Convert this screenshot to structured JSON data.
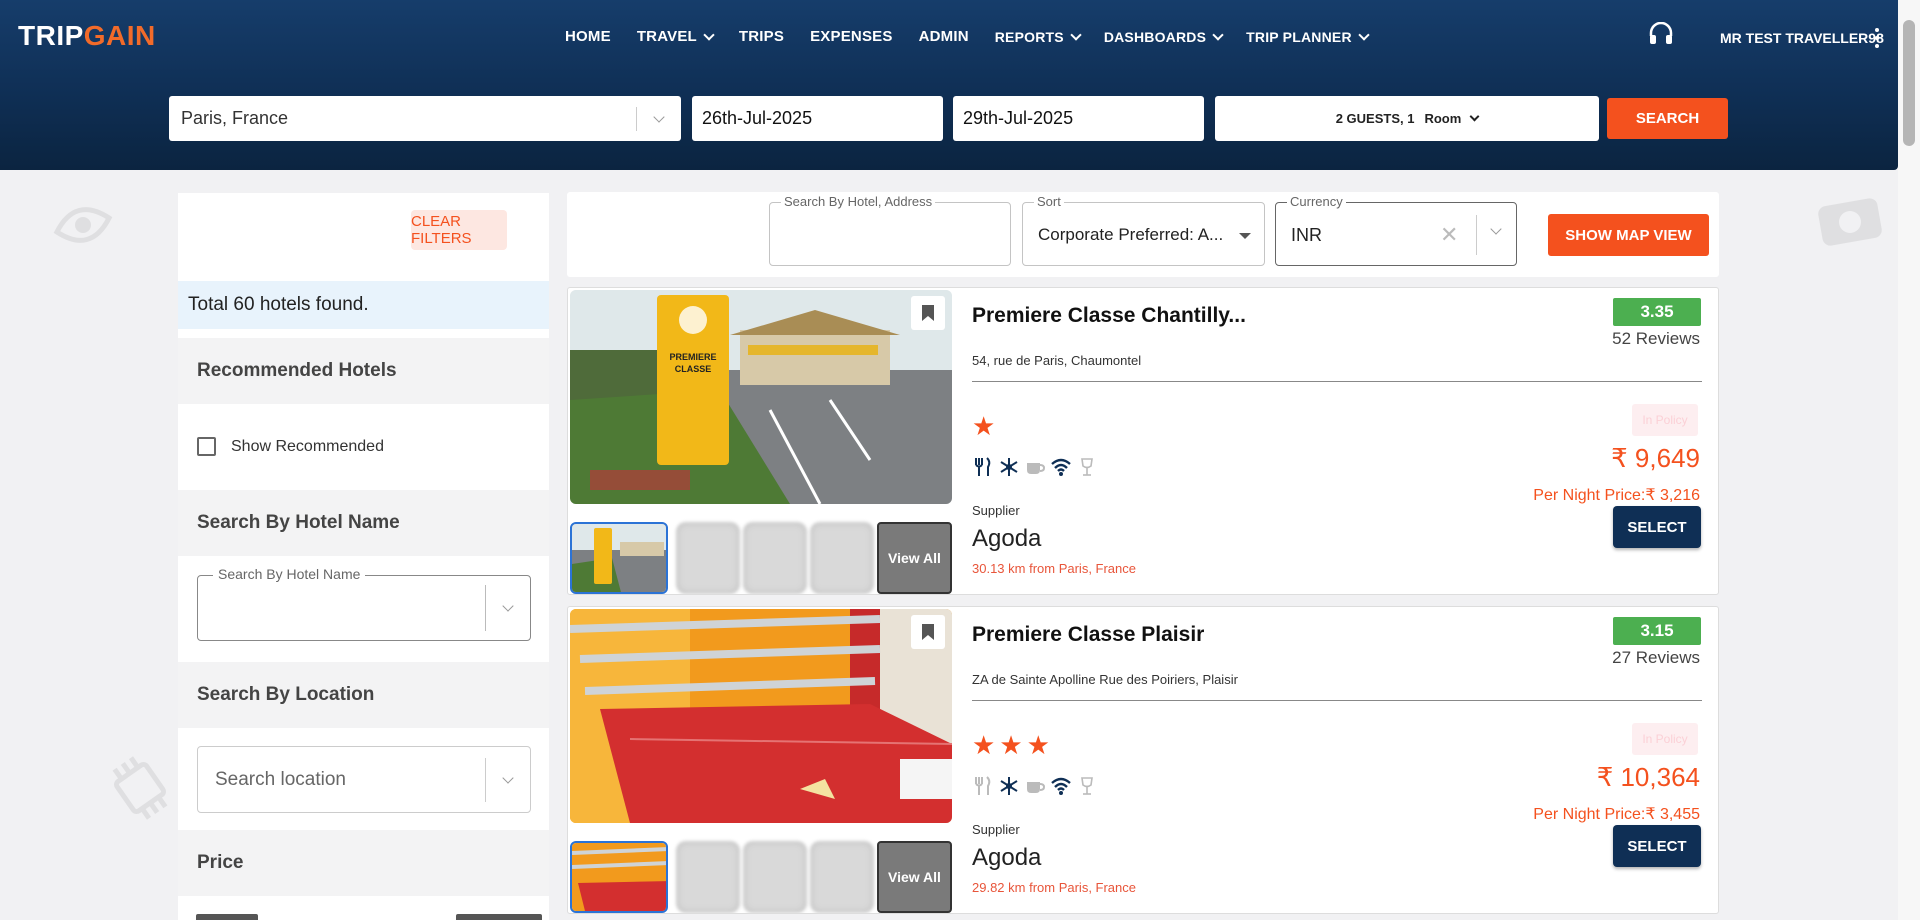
{
  "header": {
    "logo_text_a": "TRIP",
    "logo_text_b": "GAIN",
    "nav": [
      {
        "label": "HOME"
      },
      {
        "label": "TRAVEL",
        "dropdown": true
      },
      {
        "label": "TRIPS"
      },
      {
        "label": "EXPENSES"
      },
      {
        "label": "ADMIN"
      },
      {
        "label": "REPORTS",
        "dropdown": true
      },
      {
        "label": "DASHBOARDS",
        "dropdown": true
      },
      {
        "label": "TRIP PLANNER",
        "dropdown": true
      }
    ],
    "user_name": "MR TEST TRAVELLER98"
  },
  "search": {
    "destination": "Paris, France",
    "check_in": "26th-Jul-2025",
    "check_out": "29th-Jul-2025",
    "guests": "2 GUESTS, 1",
    "room": "Room",
    "search_label": "SEARCH"
  },
  "sidebar": {
    "clear_filters": "CLEAR FILTERS",
    "total": "Total 60 hotels found.",
    "recommended_title": "Recommended Hotels",
    "show_recommended": "Show Recommended",
    "hotel_name_title": "Search By Hotel Name",
    "hotel_name_legend": "Search By Hotel Name",
    "location_title": "Search By Location",
    "location_placeholder": "Search location",
    "price_title": "Price"
  },
  "toolbar": {
    "search_legend": "Search By Hotel, Address",
    "sort_legend": "Sort",
    "sort_value": "Corporate Preferred: A...",
    "currency_legend": "Currency",
    "currency_value": "INR",
    "map_button": "SHOW MAP VIEW"
  },
  "hotels": [
    {
      "name": "Premiere Classe Chantilly...",
      "address": "54, rue de Paris, Chaumontel",
      "rating": "3.35",
      "reviews": "52 Reviews",
      "stars": 1,
      "policy": "In Policy",
      "price": "₹ 9,649",
      "per_night": "Per Night Price:₹ 3,216",
      "select": "SELECT",
      "supplier_label": "Supplier",
      "supplier": "Agoda",
      "distance": "30.13 km from Paris, France",
      "view_all": "View All"
    },
    {
      "name": "Premiere Classe Plaisir",
      "address": "ZA de Sainte Apolline Rue des Poiriers, Plaisir",
      "rating": "3.15",
      "reviews": "27 Reviews",
      "stars": 3,
      "policy": "In Policy",
      "price": "₹ 10,364",
      "per_night": "Per Night Price:₹ 3,455",
      "select": "SELECT",
      "supplier_label": "Supplier",
      "supplier": "Agoda",
      "distance": "29.82 km from Paris, France",
      "view_all": "View All"
    }
  ],
  "colors": {
    "brand_orange": "#f4511e",
    "header_navy": "#0f2f55",
    "rating_green": "#4caf50"
  }
}
